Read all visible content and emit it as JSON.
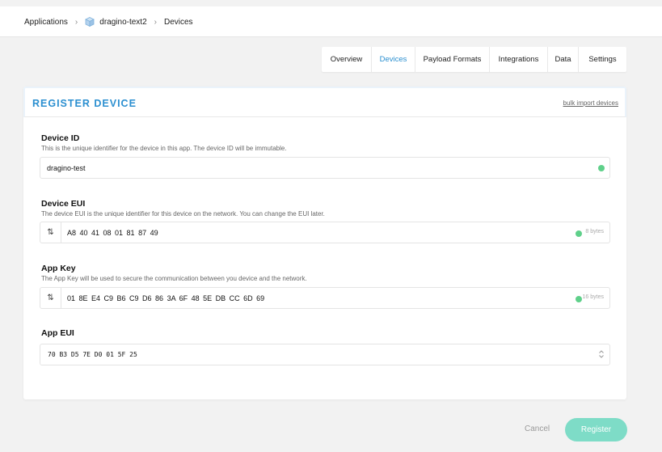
{
  "breadcrumb": {
    "applications": "Applications",
    "app_name": "dragino-text2",
    "devices": "Devices"
  },
  "tabs": [
    {
      "label": "Overview"
    },
    {
      "label": "Devices"
    },
    {
      "label": "Payload Formats"
    },
    {
      "label": "Integrations"
    },
    {
      "label": "Data"
    },
    {
      "label": "Settings"
    }
  ],
  "active_tab": "Devices",
  "card": {
    "title": "REGISTER DEVICE",
    "bulk_link": "bulk import devices"
  },
  "fields": {
    "device_id": {
      "label": "Device ID",
      "description": "This is the unique identifier for the device in this app. The device ID will be immutable.",
      "value": "dragino-test"
    },
    "device_eui": {
      "label": "Device EUI",
      "description": "The device EUI is the unique identifier for this device on the network. You can change the EUI later.",
      "value": "A8 40 41 08 01 81 87 49",
      "size_hint": "8 bytes"
    },
    "app_key": {
      "label": "App Key",
      "description": "The App Key will be used to secure the communication between you device and the network.",
      "value": "01 8E E4 C9 B6 C9 D6 86 3A 6F 48 5E DB CC 6D 69",
      "size_hint": "16 bytes"
    },
    "app_eui": {
      "label": "App EUI",
      "value": "70 B3 D5 7E D0 01 5F 25"
    }
  },
  "actions": {
    "cancel": "Cancel",
    "register": "Register"
  },
  "colors": {
    "accent": "#2b8fd0",
    "valid": "#5fd08a",
    "register_button": "#7edcc7"
  }
}
